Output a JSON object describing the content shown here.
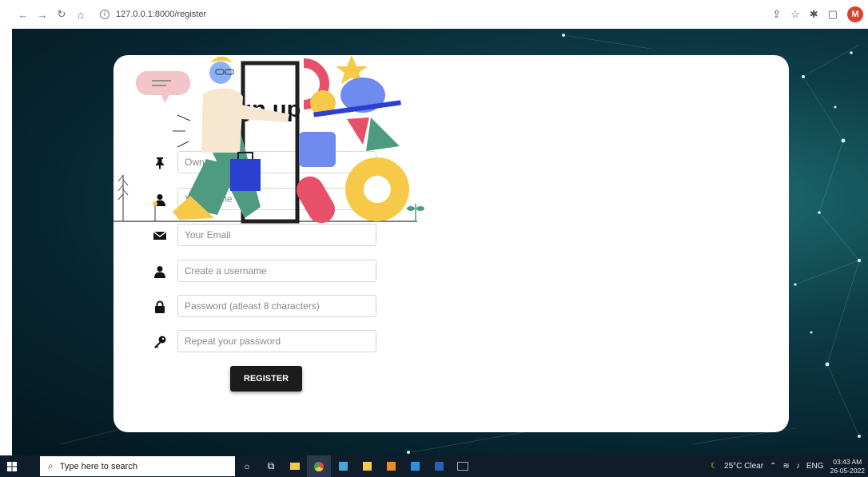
{
  "browser": {
    "url": "127.0.0.1:8000/register",
    "profile_initial": "M"
  },
  "page": {
    "title": "Sign up",
    "fields": [
      {
        "icon": "pin-icon",
        "placeholder": "Owner ID"
      },
      {
        "icon": "user-icon",
        "placeholder": "Your Name"
      },
      {
        "icon": "envelope-icon",
        "placeholder": "Your Email"
      },
      {
        "icon": "user-icon",
        "placeholder": "Create a username"
      },
      {
        "icon": "lock-icon",
        "placeholder": "Password (atleast 8 characters)"
      },
      {
        "icon": "key-icon",
        "placeholder": "Repeat your password"
      }
    ],
    "register_label": "REGISTER"
  },
  "taskbar": {
    "search_placeholder": "Type here to search",
    "weather": "25°C  Clear",
    "language": "ENG",
    "time": "03:43 AM",
    "date": "26-05-2022"
  },
  "colors": {
    "accent_blue": "#2b3fd1",
    "accent_red": "#e8506a",
    "accent_yellow": "#f7c948",
    "accent_green": "#4f9b82"
  }
}
